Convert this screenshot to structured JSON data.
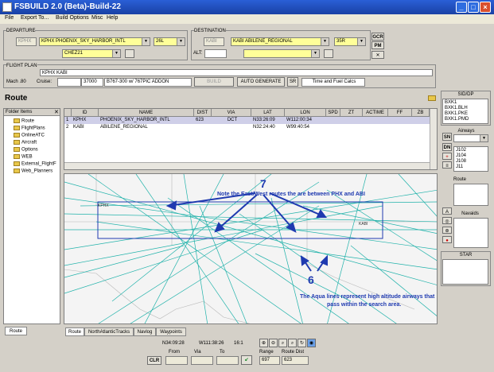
{
  "window": {
    "title": "FSBUILD 2.0 (Beta)-Build-22"
  },
  "menu": [
    "File",
    "Export To...",
    "Build Options",
    "Misc",
    "Help"
  ],
  "departure": {
    "label": "DEPARTURE",
    "icao": "KPHX",
    "airport": "KPHX PHOENIX_SKY_HARBOR_INTL",
    "runway": "26L",
    "sid": "CHEZ21"
  },
  "destination": {
    "label": "DESTINATION",
    "icao": "KABI",
    "airport": "KABI ABILENE_REGIONAL",
    "runway": "35R",
    "alt_label": "ALT:"
  },
  "side_buttons": {
    "gcr": "GCR",
    "pm": "PM"
  },
  "flight_plan": {
    "label": "FLIGHT PLAN",
    "route": "KPHX KABI",
    "mach": "Mach .80",
    "cruise_label": "Cruise:",
    "cruise": "37000",
    "aircraft": "B767-300 w/ 767PIC ADDON",
    "build": "BUILD",
    "auto_generate": "AUTO GENERATE",
    "sr": "SR",
    "time_fuel": "Time and Fuel Calcs"
  },
  "route_title": "Route",
  "folders": {
    "header": "Folder Items",
    "items": [
      "Route",
      "FlightPlans",
      "OnlineATC",
      "Aircraft",
      "Options",
      "WEB",
      "External_FlightF",
      "Web_Planners"
    ]
  },
  "table": {
    "headers": [
      "ID",
      "NAME",
      "DIST",
      "VIA",
      "LAT",
      "LON",
      "SPD",
      "ZT",
      "ACTIME",
      "FF",
      "ZB"
    ],
    "rows": [
      {
        "n": "1",
        "id": "KPHX",
        "name": "PHOENIX_SKY_HARBOR_INTL",
        "dist": "623",
        "via": "DCT",
        "lat": "N33:26:09",
        "lon": "W112:00:34"
      },
      {
        "n": "2",
        "id": "KABI",
        "name": "ABILENE_REGIONAL",
        "dist": "",
        "via": "",
        "lat": "N32:24:40",
        "lon": "W99:40:54"
      }
    ]
  },
  "annotations": {
    "num7": "7",
    "note7": "Note the East/West routes the are between PHX and ABI",
    "num6": "6",
    "note6a": "The Aqua lines represent high altitude airways that",
    "note6b": "pass within the search area."
  },
  "map_labels": {
    "left": "KPHX",
    "right": "KABI"
  },
  "bottom_tabs": [
    "Route",
    "NorthAtlanticTracks",
    "Navlog",
    "Waypoints"
  ],
  "left_tab": "Route",
  "status": {
    "lat": "N34:09:28",
    "lon": "W111:38:26",
    "zoom": "16:1",
    "from_label": "From",
    "via_label": "Via",
    "to_label": "To",
    "clr": "CLR",
    "range_label": "Range",
    "route_dist_label": "Route Dist",
    "range": "697",
    "route_dist": "623"
  },
  "right": {
    "sid_label": "SID/DP",
    "sid_items": [
      "BXK1",
      "BXK1.BLH",
      "BXK1.PKE",
      "BXK1.PMD"
    ],
    "airways_label": "Airways",
    "sn": "SN",
    "dn": "DN",
    "airway_items": [
      "J102",
      "J104",
      "J108",
      "J11"
    ],
    "route_label": "Route",
    "navaids_label": "Navaids",
    "star_label": "STAR"
  },
  "colors": {
    "aqua": "#20b2aa",
    "annotation": "#1f3ab0",
    "title": "#1941a5"
  }
}
